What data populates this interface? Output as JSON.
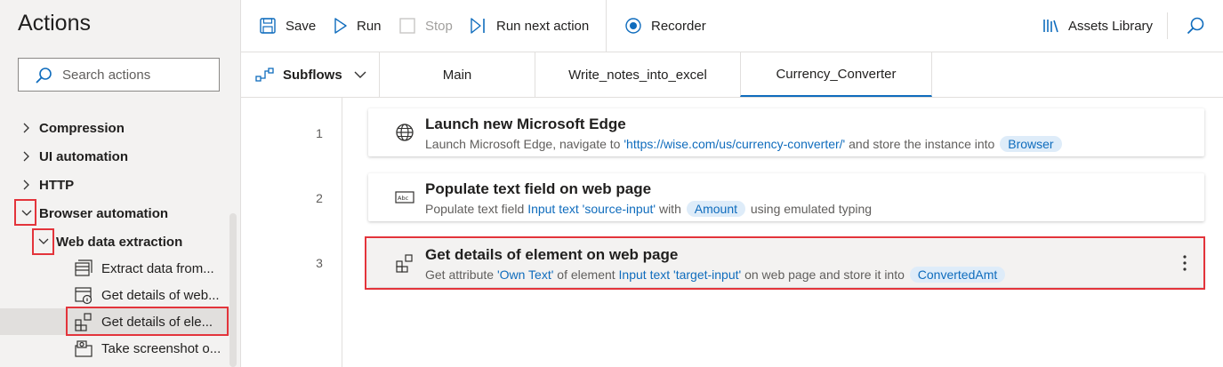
{
  "sidebar": {
    "title": "Actions",
    "search_placeholder": "Search actions",
    "groups": [
      {
        "label": "Compression"
      },
      {
        "label": "UI automation"
      },
      {
        "label": "HTTP"
      },
      {
        "label": "Browser automation"
      }
    ],
    "subgroup": {
      "label": "Web data extraction"
    },
    "leaves": [
      {
        "label": "Extract data from...",
        "icon": "table-icon"
      },
      {
        "label": "Get details of web...",
        "icon": "webpage-info-icon"
      },
      {
        "label": "Get details of ele...",
        "icon": "element-icon"
      },
      {
        "label": "Take screenshot o...",
        "icon": "screenshot-icon"
      }
    ]
  },
  "toolbar": {
    "save": "Save",
    "run": "Run",
    "stop": "Stop",
    "run_next": "Run next action",
    "recorder": "Recorder",
    "assets": "Assets Library"
  },
  "tabs": {
    "subflows": "Subflows",
    "items": [
      "Main",
      "Write_notes_into_excel",
      "Currency_Converter"
    ],
    "active": "Currency_Converter"
  },
  "steps": [
    {
      "num": "1",
      "title": "Launch new Microsoft Edge",
      "desc": {
        "t1": "Launch Microsoft Edge, navigate to ",
        "link1": "'https://wise.com/us/currency-converter/'",
        "t2": " and store the instance into ",
        "var1": "Browser"
      }
    },
    {
      "num": "2",
      "title": "Populate text field on web page",
      "desc": {
        "t1": "Populate text field ",
        "link1": "Input text 'source-input'",
        "t2": " with ",
        "var1": "Amount",
        "t3": " using emulated typing"
      }
    },
    {
      "num": "3",
      "title": "Get details of element on web page",
      "desc": {
        "t1": "Get attribute ",
        "link1": "'Own Text'",
        "t2": " of element ",
        "link2": "Input text 'target-input'",
        "t3": " on web page and store it into ",
        "var1": "ConvertedAmt"
      }
    }
  ],
  "colors": {
    "accent": "#0f6cbd",
    "highlight": "#e3343b",
    "variable_bg": "#deecf9"
  }
}
